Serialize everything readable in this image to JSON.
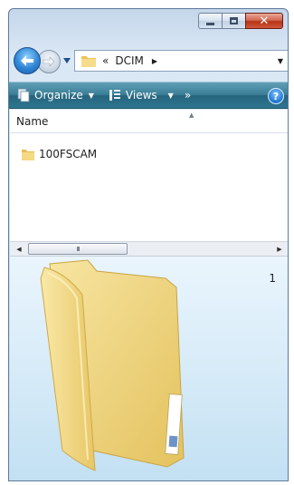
{
  "window": {
    "caption": {
      "close_glyph": "✕"
    }
  },
  "address_bar": {
    "overflow_chevrons": "«",
    "path_segment": "DCIM",
    "segment_arrow": "▶",
    "dropdown_arrow": "▼"
  },
  "toolbar": {
    "organize_label": "Organize",
    "views_label": "Views",
    "dropdown_arrow": "▼",
    "more_chevrons": "»",
    "help_glyph": "?"
  },
  "file_list": {
    "column_header": "Name",
    "sort_caret": "▲",
    "items": [
      {
        "name": "100FSCAM",
        "icon": "folder-icon"
      }
    ]
  },
  "scrollbar": {
    "left_arrow": "◀",
    "right_arrow": "▶",
    "thumb_grip": "III"
  },
  "preview": {
    "item_count": "1",
    "icon": "large-folder-icon"
  },
  "colors": {
    "command_bar": "#3a7e96",
    "close_button": "#c44128",
    "folder_yellow": "#f3d77e",
    "preview_bg": "#d3e9f7"
  }
}
